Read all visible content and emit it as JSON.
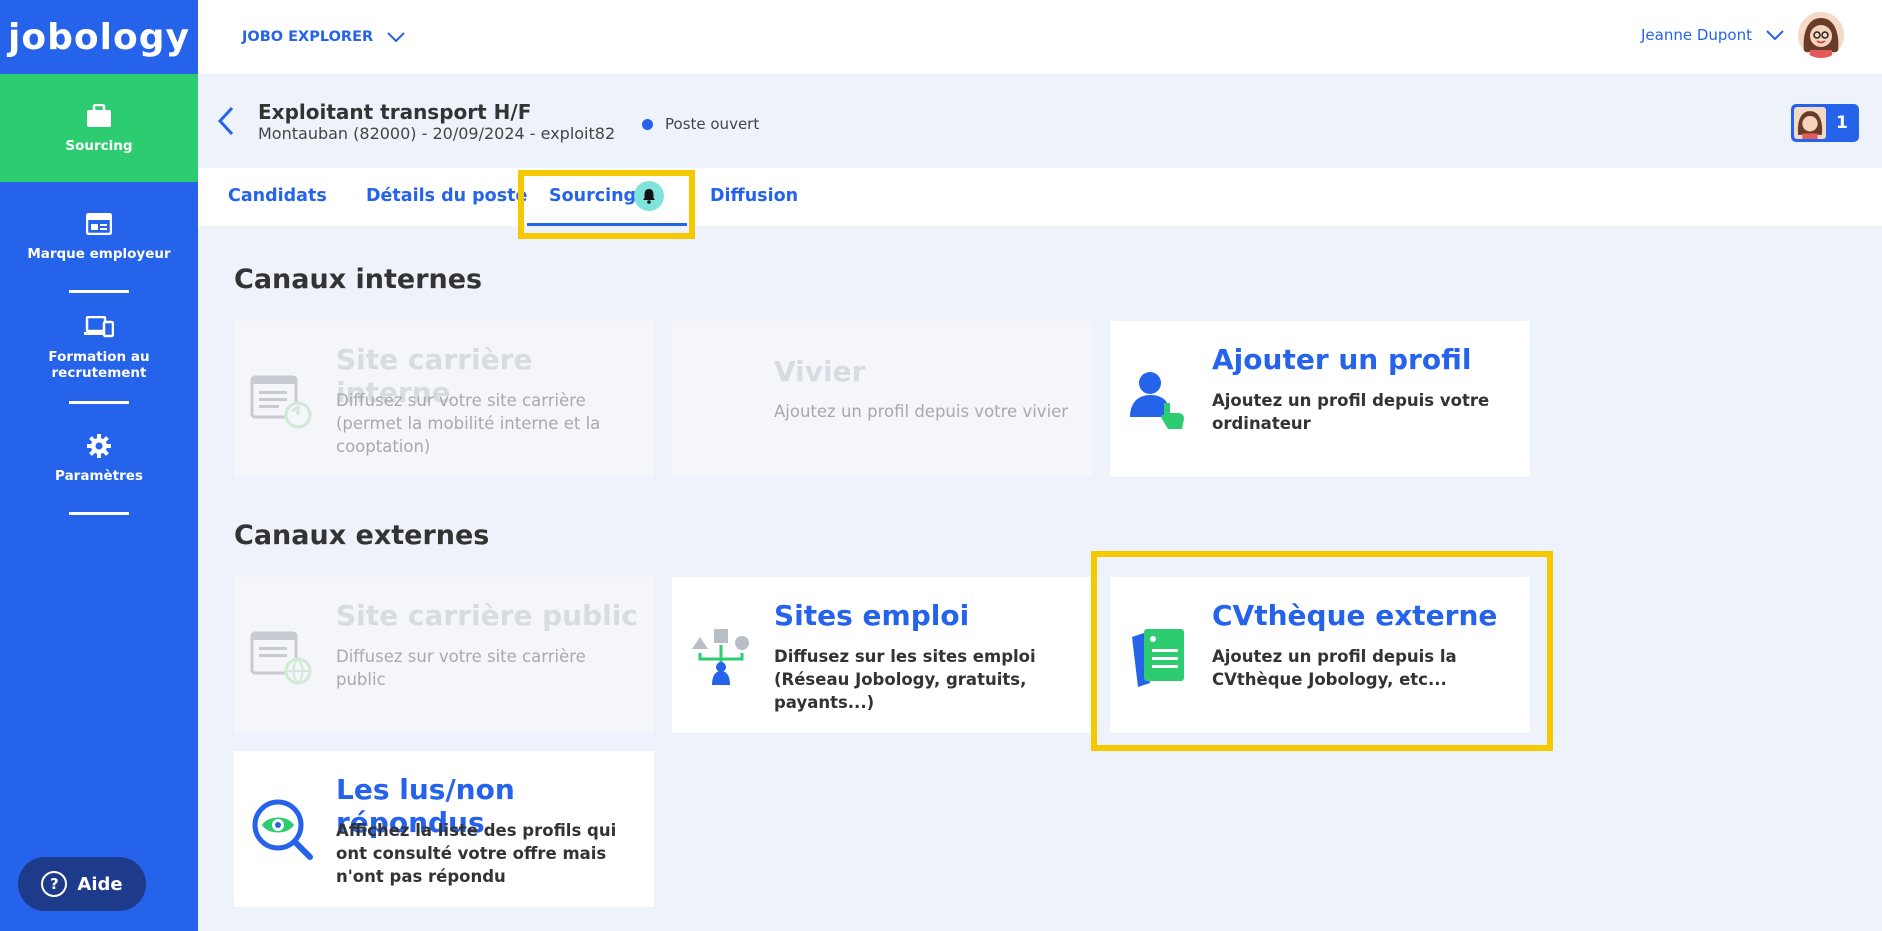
{
  "brand": {
    "logo_text": "jobology"
  },
  "sidebar": {
    "items": [
      {
        "label": "Sourcing",
        "icon": "briefcase-icon",
        "active": true
      },
      {
        "label": "Marque employeur",
        "icon": "browser-icon"
      },
      {
        "label": "Formation au recrutement",
        "icon": "devices-icon"
      },
      {
        "label": "Paramètres",
        "icon": "gear-icon"
      }
    ],
    "help_label": "Aide"
  },
  "topbar": {
    "explorer_label": "JOBO EXPLORER",
    "user_name": "Jeanne Dupont"
  },
  "job": {
    "title": "Exploitant transport H/F",
    "subtitle": "Montauban (82000) - 20/09/2024 - exploit82",
    "status": "Poste ouvert",
    "team_count": "1"
  },
  "tabs": [
    {
      "label": "Candidats"
    },
    {
      "label": "Détails du poste"
    },
    {
      "label": "Sourcing",
      "active": true
    },
    {
      "label": "Diffusion"
    }
  ],
  "internal": {
    "title": "Canaux internes",
    "cards": [
      {
        "title": "Site carrière interne",
        "desc": "Diffusez sur votre site carrière (permet la mobilité interne et la cooptation)",
        "disabled": true
      },
      {
        "title": "Vivier",
        "desc": "Ajoutez un profil depuis votre vivier",
        "disabled": true
      },
      {
        "title": "Ajouter un profil",
        "desc": "Ajoutez un profil depuis votre ordinateur",
        "disabled": false
      }
    ]
  },
  "external": {
    "title": "Canaux externes",
    "cards": [
      {
        "title": "Site carrière public",
        "desc": "Diffusez sur votre site carrière public",
        "disabled": true
      },
      {
        "title": "Sites emploi",
        "desc": "Diffusez sur les sites emploi (Réseau Jobology, gratuits, payants...)",
        "disabled": false
      },
      {
        "title": "CVthèque externe",
        "desc": "Ajoutez un profil depuis la CVthèque Jobology, etc...",
        "disabled": false
      },
      {
        "title": "Les lus/non répondus",
        "desc": "Affichez la liste des profils qui ont consulté votre offre mais n'ont pas répondu",
        "disabled": false
      }
    ]
  },
  "colors": {
    "primary": "#2563eb",
    "sidebar_active": "#2ecc71",
    "highlight": "#f5c800",
    "help_button": "#1e3a8a"
  }
}
